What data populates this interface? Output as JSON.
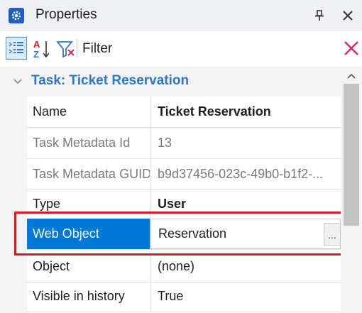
{
  "window": {
    "title": "Properties",
    "pin_icon": "pin-icon",
    "close_icon": "close-icon"
  },
  "toolbar": {
    "categorized_icon": "categorized-view-icon",
    "alphabetical_icon": "sort-az-icon",
    "filter_icon": "filter-icon",
    "filter_label": "Filter",
    "search_value": "",
    "search_placeholder": "",
    "clear_icon": "clear-filter-icon"
  },
  "category": {
    "label": "Task: Ticket Reservation",
    "expanded": true
  },
  "properties": [
    {
      "name": "Name",
      "value": "Ticket Reservation",
      "bold": true,
      "readonly": false
    },
    {
      "name": "Task Metadata Id",
      "value": "13",
      "bold": false,
      "readonly": true
    },
    {
      "name": "Task Metadata GUID",
      "value": "b9d37456-023c-49b0-b1f2-...",
      "bold": false,
      "readonly": true
    },
    {
      "name": "Type",
      "value": "User",
      "bold": true,
      "readonly": false
    },
    {
      "name": "Web Object",
      "value": "Reservation",
      "bold": false,
      "readonly": false,
      "selected": true,
      "ellipsis": "..."
    },
    {
      "name": "Object",
      "value": "(none)",
      "bold": false,
      "readonly": false
    },
    {
      "name": "Visible in history",
      "value": "True",
      "bold": false,
      "readonly": false
    }
  ],
  "colors": {
    "accent": "#0078d7",
    "category_text": "#2f78c5",
    "highlight": "#d9181e",
    "clear_icon": "#e0245e"
  }
}
